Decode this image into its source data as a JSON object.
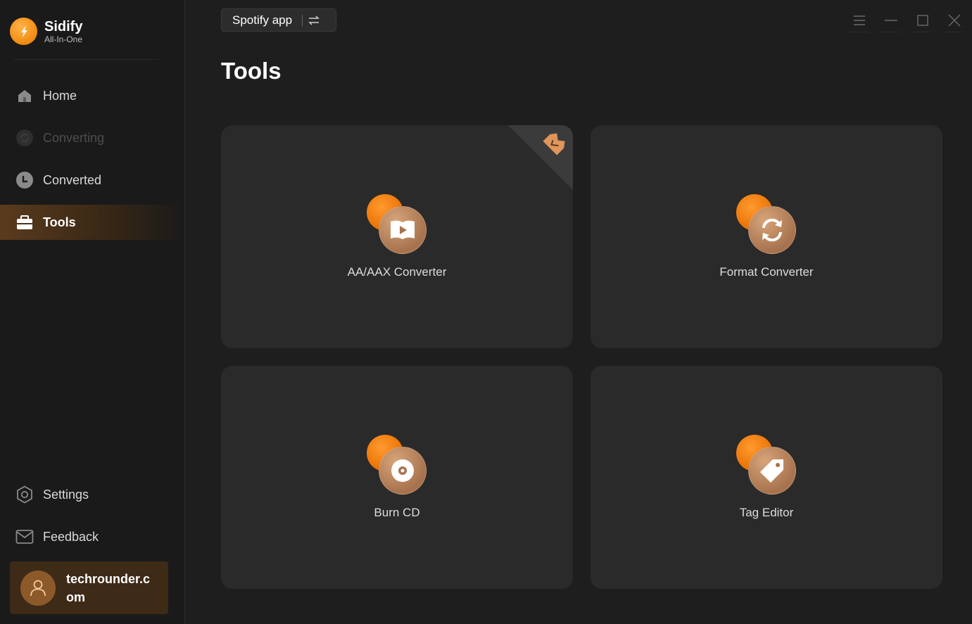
{
  "brand": {
    "name": "Sidify",
    "subtitle": "All-In-One"
  },
  "sidebar": {
    "items": [
      {
        "label": "Home",
        "icon": "home-icon",
        "state": "normal"
      },
      {
        "label": "Converting",
        "icon": "converting-icon",
        "state": "disabled"
      },
      {
        "label": "Converted",
        "icon": "clock-icon",
        "state": "normal"
      },
      {
        "label": "Tools",
        "icon": "toolbox-icon",
        "state": "active"
      }
    ],
    "bottom_items": [
      {
        "label": "Settings",
        "icon": "gear-icon"
      },
      {
        "label": "Feedback",
        "icon": "mail-icon"
      }
    ],
    "user": {
      "name": "techrounder.com",
      "icon": "user-icon"
    }
  },
  "header": {
    "source_label": "Spotify app",
    "window_controls": [
      "menu-icon",
      "minimize-icon",
      "maximize-icon",
      "close-icon"
    ]
  },
  "main": {
    "title": "Tools",
    "tools": [
      {
        "label": "AA/AAX Converter",
        "icon": "audiobook-icon",
        "premium": true
      },
      {
        "label": "Format Converter",
        "icon": "refresh-icon",
        "premium": false
      },
      {
        "label": "Burn CD",
        "icon": "cd-icon",
        "premium": false
      },
      {
        "label": "Tag Editor",
        "icon": "tag-icon",
        "premium": false
      }
    ]
  },
  "colors": {
    "accent": "#f08a10",
    "background": "#1e1e1e",
    "sidebar": "#1a1a1a",
    "card": "#2a2a2a",
    "user_card": "#3d2a17"
  }
}
